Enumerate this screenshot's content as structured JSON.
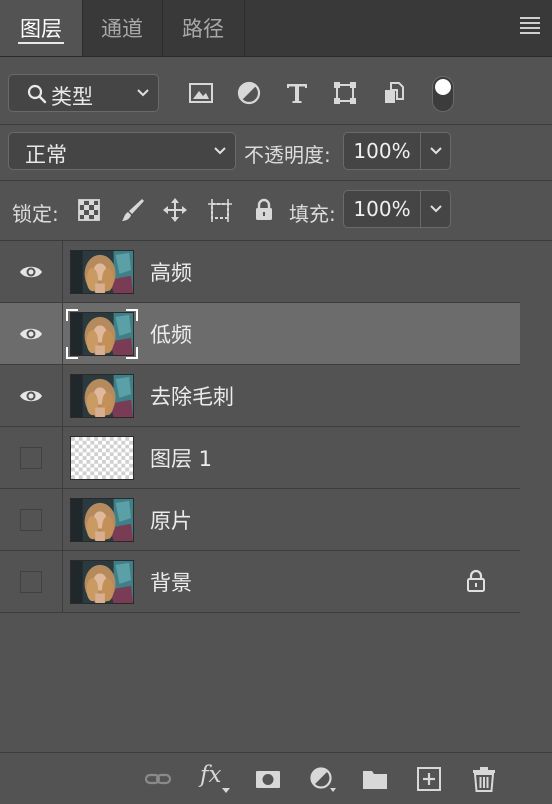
{
  "tabs": [
    {
      "label": "图层",
      "active": true
    },
    {
      "label": "通道",
      "active": false
    },
    {
      "label": "路径",
      "active": false
    }
  ],
  "filter": {
    "kind_label": "类型",
    "icons": [
      "image-filter-icon",
      "adjustment-filter-icon",
      "type-filter-icon",
      "shape-filter-icon",
      "smart-object-filter-icon"
    ],
    "toggle_on": true
  },
  "blend": {
    "mode": "正常",
    "opacity_label": "不透明度:",
    "opacity_value": "100%"
  },
  "lock": {
    "label": "锁定:",
    "icons": [
      "lock-transparent-pixels-icon",
      "lock-image-pixels-icon",
      "lock-position-icon",
      "lock-artboard-icon",
      "lock-all-icon"
    ],
    "fill_label": "填充:",
    "fill_value": "100%"
  },
  "layers": [
    {
      "name": "高频",
      "visible": true,
      "selected": false,
      "thumb": "photo",
      "locked": false
    },
    {
      "name": "低频",
      "visible": true,
      "selected": true,
      "thumb": "photo",
      "locked": false
    },
    {
      "name": "去除毛刺",
      "visible": true,
      "selected": false,
      "thumb": "photo",
      "locked": false
    },
    {
      "name": "图层 1",
      "visible": false,
      "selected": false,
      "thumb": "transparent",
      "locked": false
    },
    {
      "name": "原片",
      "visible": false,
      "selected": false,
      "thumb": "photo",
      "locked": false
    },
    {
      "name": "背景",
      "visible": false,
      "selected": false,
      "thumb": "photo",
      "locked": true
    }
  ],
  "bottom_icons": [
    "link-layers-icon",
    "fx-icon",
    "add-mask-icon",
    "new-adjustment-icon",
    "new-group-icon",
    "new-layer-icon",
    "delete-layer-icon"
  ],
  "bottom_fx_label": "fx",
  "colors": {
    "panel_bg": "#535353",
    "tab_bar_bg": "#393939",
    "selected_row": "#6c6c6c",
    "field_bg": "#454545"
  }
}
